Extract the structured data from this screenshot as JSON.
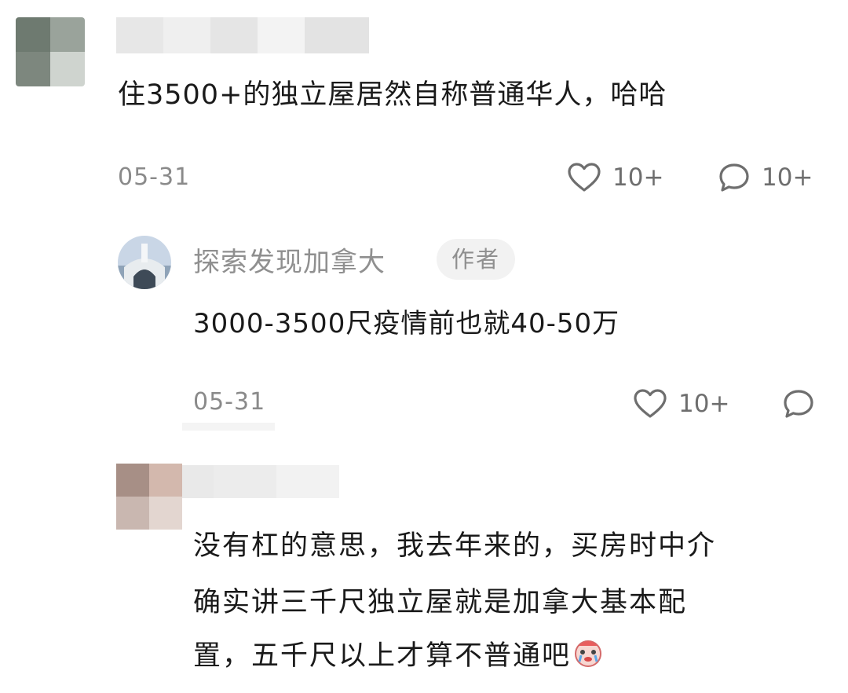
{
  "colors": {
    "text": "#1a1a1a",
    "meta": "#8a8a8a",
    "author_tag_bg": "#f2f2f2",
    "icon": "#6e6e6e"
  },
  "comments": [
    {
      "avatar": "pixelated-avatar",
      "username": "",
      "text": "住3500+的独立屋居然自称普通华人，哈哈",
      "date": "05-31",
      "likes": "10+",
      "replies": "10+"
    },
    {
      "avatar": "photo-avatar",
      "username": "探索发现加拿大",
      "author_tag": "作者",
      "text": "3000-3500尺疫情前也就40-50万",
      "date": "05-31",
      "likes": "10+"
    },
    {
      "avatar": "pixelated-avatar",
      "username": "",
      "text_lines": [
        "没有杠的意思，我去年来的，买房时中介",
        "确实讲三千尺独立屋就是加拿大基本配",
        "置，五千尺以上才算不普通吧"
      ],
      "emoji": "crying-clown-emoji"
    }
  ],
  "icons": {
    "like": "heart-outline-icon",
    "reply": "chat-bubble-icon"
  }
}
